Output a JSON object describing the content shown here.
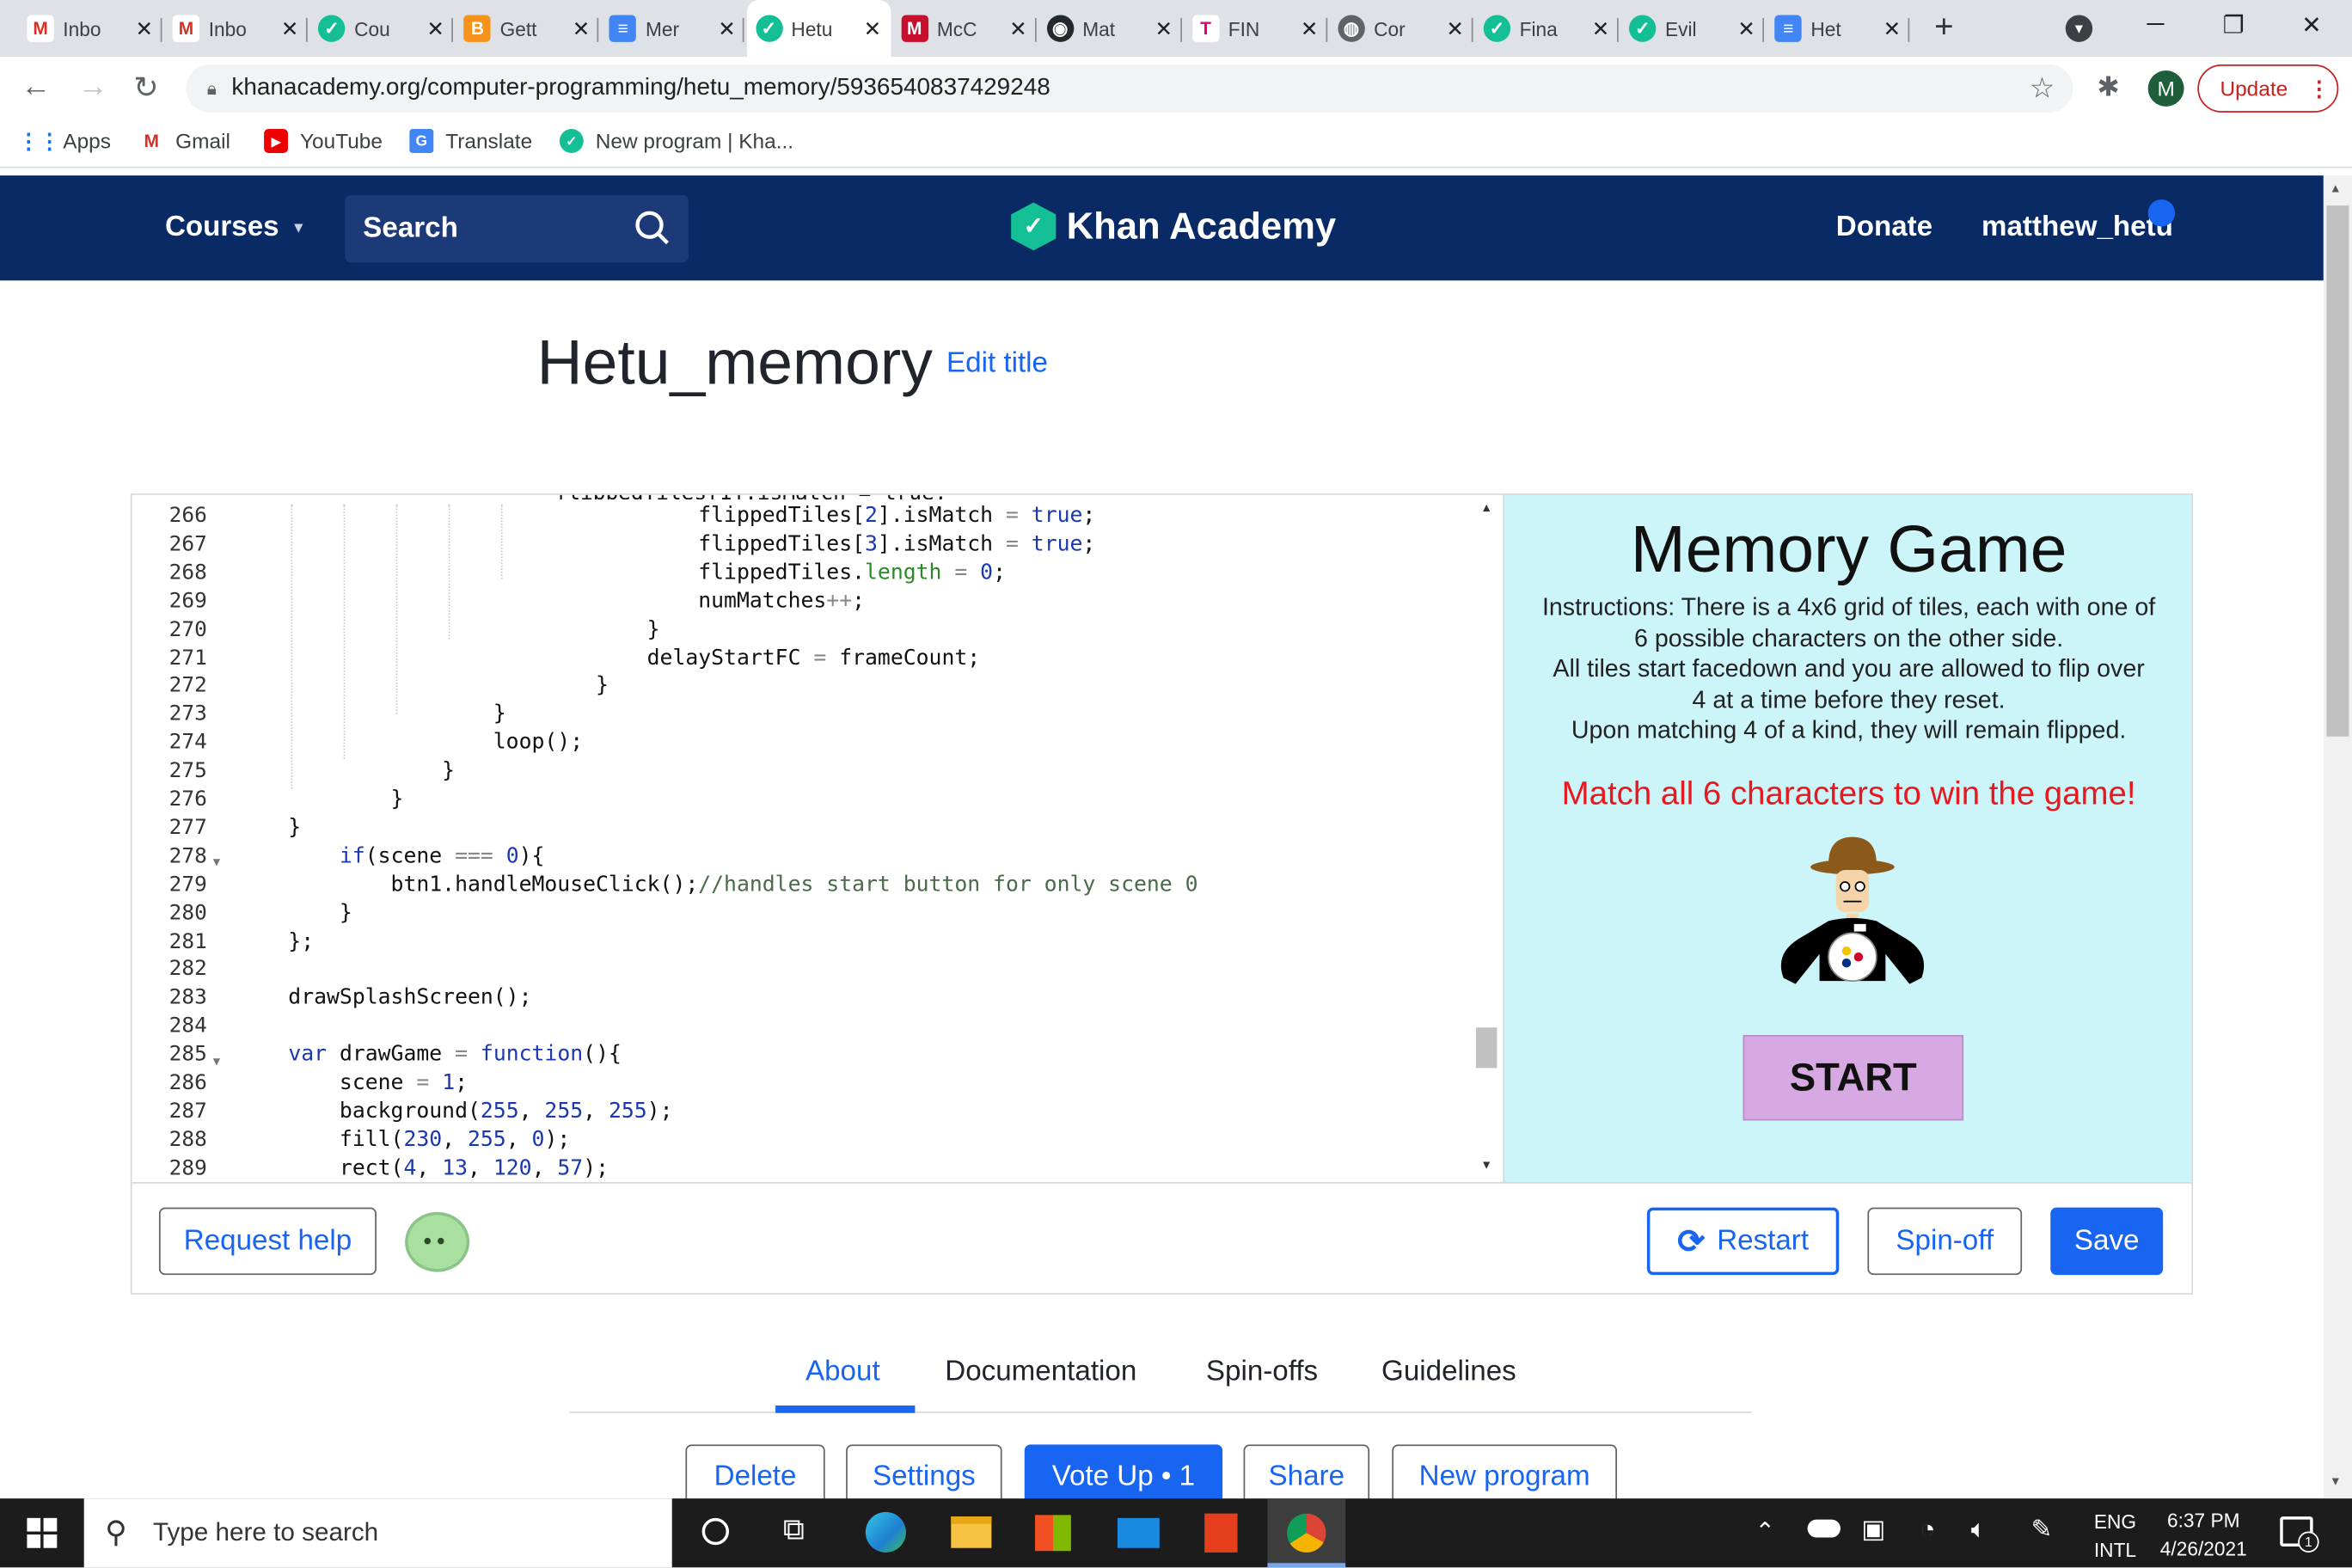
{
  "browser": {
    "tabs": [
      {
        "title": "Inbo",
        "icon": "gmail-icon"
      },
      {
        "title": "Inbo",
        "icon": "gmail-icon"
      },
      {
        "title": "Cou",
        "icon": "course-icon"
      },
      {
        "title": "Gett",
        "icon": "b-icon"
      },
      {
        "title": "Mer",
        "icon": "docs-icon"
      },
      {
        "title": "Hetu",
        "icon": "khan-icon"
      },
      {
        "title": "McC",
        "icon": "m-icon"
      },
      {
        "title": "Mat",
        "icon": "github-icon"
      },
      {
        "title": "FIN",
        "icon": "t-icon"
      },
      {
        "title": "Cor",
        "icon": "globe-icon"
      },
      {
        "title": "Fina",
        "icon": "khan-icon"
      },
      {
        "title": "Evil",
        "icon": "khan-icon"
      },
      {
        "title": "Het",
        "icon": "docs-icon"
      }
    ],
    "url": "khanacademy.org/computer-programming/hetu_memory/5936540837429248",
    "profile_initial": "M",
    "update_label": "Update",
    "bookmarks": [
      "Apps",
      "Gmail",
      "YouTube",
      "Translate",
      "New program | Kha..."
    ]
  },
  "ka_nav": {
    "courses": "Courses",
    "search": "Search",
    "logo": "Khan Academy",
    "donate": "Donate",
    "user": "matthew_hetu"
  },
  "program": {
    "title": "Hetu_memory",
    "edit_title": "Edit title"
  },
  "code_lines": [
    {
      "n": "266",
      "html": "                                    flippedTiles[<span class='num'>2</span>].isMatch <span class='op'>=</span> <span class='kw'>true</span>;"
    },
    {
      "n": "267",
      "html": "                                    flippedTiles[<span class='num'>3</span>].isMatch <span class='op'>=</span> <span class='kw'>true</span>;"
    },
    {
      "n": "268",
      "html": "                                    flippedTiles.<span class='pr'>length</span> <span class='op'>=</span> <span class='num'>0</span>;"
    },
    {
      "n": "269",
      "html": "                                    numMatches<span class='op'>++</span>;"
    },
    {
      "n": "270",
      "html": "                                }"
    },
    {
      "n": "271",
      "html": "                                delayStartFC <span class='op'>=</span> frameCount;"
    },
    {
      "n": "272",
      "html": "                            }"
    },
    {
      "n": "273",
      "html": "                    }"
    },
    {
      "n": "274",
      "html": "                    loop();"
    },
    {
      "n": "275",
      "html": "                }"
    },
    {
      "n": "276",
      "html": "            }"
    },
    {
      "n": "277",
      "html": "    }"
    },
    {
      "n": "278",
      "html": "        <span class='kw'>if</span>(scene <span class='op'>===</span> <span class='num'>0</span>){"
    },
    {
      "n": "279",
      "html": "            btn1.handleMouseClick();<span class='cm'>//handles start button for only scene 0</span>"
    },
    {
      "n": "280",
      "html": "        }"
    },
    {
      "n": "281",
      "html": "    };"
    },
    {
      "n": "282",
      "html": ""
    },
    {
      "n": "283",
      "html": "    drawSplashScreen();"
    },
    {
      "n": "284",
      "html": ""
    },
    {
      "n": "285",
      "html": "    <span class='kw'>var</span> drawGame <span class='op'>=</span> <span class='kw'>function</span>(){"
    },
    {
      "n": "286",
      "html": "        scene <span class='op'>=</span> <span class='num'>1</span>;"
    },
    {
      "n": "287",
      "html": "        background(<span class='num'>255</span>, <span class='num'>255</span>, <span class='num'>255</span>);"
    },
    {
      "n": "288",
      "html": "        fill(<span class='num'>230</span>, <span class='num'>255</span>, <span class='num'>0</span>);"
    },
    {
      "n": "289",
      "html": "        rect(<span class='num'>4</span>, <span class='num'>13</span>, <span class='num'>120</span>, <span class='num'>57</span>);"
    }
  ],
  "canvas": {
    "title": "Memory Game",
    "instructions": [
      "Instructions: There is a 4x6 grid of tiles, each with one of",
      "6 possible characters on the other side.",
      "All tiles start facedown and you are allowed to flip over",
      "4 at a time before they reset.",
      "Upon matching 4 of a kind, they will remain flipped."
    ],
    "goal": "Match all 6 characters to win the game!",
    "start": "START"
  },
  "editor_buttons": {
    "request_help": "Request help",
    "restart": "Restart",
    "spinoff": "Spin-off",
    "save": "Save"
  },
  "tabs": [
    "About",
    "Documentation",
    "Spin-offs",
    "Guidelines"
  ],
  "actions": [
    "Delete",
    "Settings",
    "Vote Up • 1",
    "Share",
    "New program"
  ],
  "taskbar": {
    "search": "Type here to search",
    "lang1": "ENG",
    "lang2": "INTL",
    "time": "6:37 PM",
    "date": "4/26/2021",
    "notif": "1"
  }
}
